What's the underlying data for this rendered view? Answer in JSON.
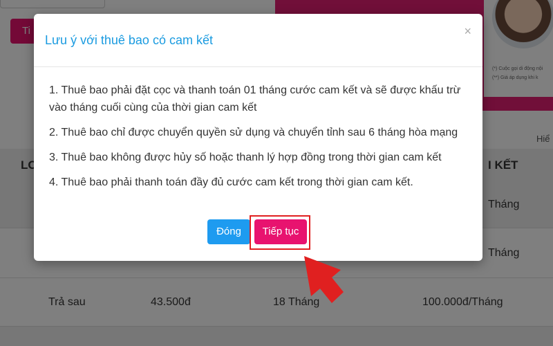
{
  "background": {
    "button_label": "Ti",
    "banner_notes": [
      "(*) Cuộc gọi di động nội",
      "(**) Giá áp dụng khi k"
    ],
    "hint": "Hiể",
    "header": {
      "left": "LO",
      "right": "I KẾT"
    },
    "rows": [
      {
        "type": "",
        "price": "",
        "term": "",
        "commit": "Tháng"
      },
      {
        "type": "",
        "price": "",
        "term": "",
        "commit": "Tháng"
      },
      {
        "type": "Trả sau",
        "price": "43.500đ",
        "term": "18 Tháng",
        "commit": "100.000đ/Tháng"
      }
    ]
  },
  "modal": {
    "title": "Lưu ý với thuê bao có cam kết",
    "close_symbol": "×",
    "rules": [
      "1. Thuê bao phải đặt cọc và thanh toán 01 tháng cước cam kết và sẽ được khấu trừ vào tháng cuối cùng của thời gian cam kết",
      "2. Thuê bao chỉ được chuyển quyền sử dụng và chuyển tỉnh sau 6 tháng hòa mạng",
      "3. Thuê bao không được hủy số hoặc thanh lý hợp đồng trong thời gian cam kết",
      "4. Thuê bao phải thanh toán đầy đủ cước cam kết trong thời gian cam kết."
    ],
    "buttons": {
      "close_label": "Đóng",
      "continue_label": "Tiếp tục"
    }
  },
  "colors": {
    "title": "#1a9be0",
    "close_button": "#1e9bf0",
    "continue_button": "#e8136f",
    "highlight": "#e02020",
    "arrow": "#e02020"
  }
}
